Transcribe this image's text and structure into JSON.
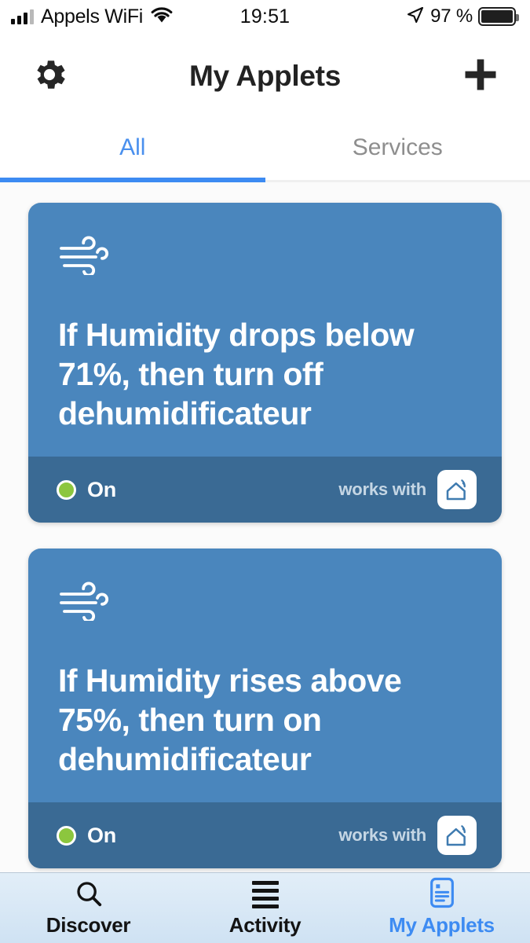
{
  "status_bar": {
    "carrier": "Appels WiFi",
    "time": "19:51",
    "battery_percent": "97 %",
    "signal_bars_filled": 3,
    "signal_bars_total": 4,
    "icons": [
      "signal-bars-icon",
      "wifi-icon",
      "location-arrow-icon",
      "battery-icon"
    ]
  },
  "header": {
    "title": "My Applets",
    "left_icon": "gear-icon",
    "right_icon": "plus-icon"
  },
  "tabs": {
    "items": [
      {
        "label": "All",
        "active": true
      },
      {
        "label": "Services",
        "active": false
      }
    ],
    "active_color": "#3d8bf2",
    "inactive_color": "#8e8e8e"
  },
  "applets": [
    {
      "icon": "wind-icon",
      "title": "If Humidity drops below 71%, then turn off dehumidificateur",
      "status_label": "On",
      "status_color": "#8cc63e",
      "works_with_label": "works with",
      "service_icon": "smart-home-icon",
      "card_color": "#4a86bd",
      "footer_color": "#3a6a94"
    },
    {
      "icon": "wind-icon",
      "title": "If Humidity rises above 75%, then turn on dehumidificateur",
      "status_label": "On",
      "status_color": "#8cc63e",
      "works_with_label": "works with",
      "service_icon": "smart-home-icon",
      "card_color": "#4a86bd",
      "footer_color": "#3a6a94"
    }
  ],
  "bottom_nav": {
    "items": [
      {
        "label": "Discover",
        "icon": "search-icon",
        "active": false
      },
      {
        "label": "Activity",
        "icon": "list-icon",
        "active": false
      },
      {
        "label": "My Applets",
        "icon": "document-icon",
        "active": true
      }
    ],
    "active_color": "#3d8bf2"
  }
}
